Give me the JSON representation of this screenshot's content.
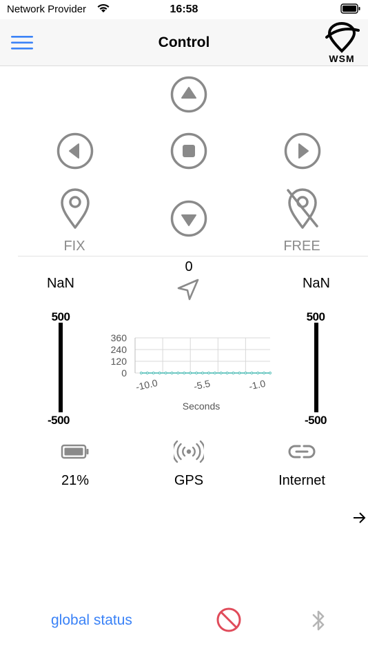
{
  "status_bar": {
    "carrier": "Network Provider",
    "time": "16:58",
    "icons": [
      "wifi-icon",
      "battery-icon"
    ]
  },
  "nav": {
    "title": "Control",
    "menu_icon": "hamburger-menu-icon",
    "logo_text": "WSM"
  },
  "controls": {
    "buttons": [
      "arrow-up-circle",
      "arrow-left-circle",
      "stop-circle",
      "arrow-right-circle",
      "arrow-down-circle"
    ],
    "fix_label": "FIX",
    "free_label": "FREE"
  },
  "heading": {
    "value": "0",
    "icon": "navigation-arrow-icon"
  },
  "left_reading": "NaN",
  "right_reading": "NaN",
  "left_gauge": {
    "max": "500",
    "min": "-500"
  },
  "right_gauge": {
    "max": "500",
    "min": "-500"
  },
  "chart_data": {
    "type": "line",
    "xlabel": "Seconds",
    "ylabel": "",
    "y_ticks": [
      "360",
      "240",
      "120",
      "0"
    ],
    "x_ticks": [
      "-10.0",
      "-5.5",
      "-1.0"
    ],
    "ylim": [
      0,
      360
    ],
    "xlim": [
      -11,
      0
    ],
    "series": [
      {
        "color": "#40b7b0",
        "x": [
          -10.5,
          -10.0,
          -9.5,
          -9.0,
          -8.5,
          -8.0,
          -7.5,
          -7.0,
          -6.5,
          -6.0,
          -5.5,
          -5.0,
          -4.5,
          -4.0,
          -3.5,
          -3.0,
          -2.5,
          -2.0,
          -1.5,
          -1.0,
          -0.5,
          0.0
        ],
        "values": [
          0,
          0,
          0,
          0,
          0,
          0,
          0,
          0,
          0,
          0,
          0,
          0,
          0,
          0,
          0,
          0,
          0,
          0,
          0,
          0,
          0,
          0
        ]
      }
    ]
  },
  "status": {
    "battery": {
      "icon": "battery-icon",
      "label": "21%"
    },
    "gps": {
      "icon": "gps-signal-icon",
      "label": "GPS"
    },
    "internet": {
      "icon": "link-icon",
      "label": "Internet"
    }
  },
  "bottom": {
    "global_status": "global status",
    "ban_icon": "no-entry-icon",
    "bluetooth_icon": "bluetooth-icon"
  },
  "colors": {
    "accent": "#3a82f7",
    "control_gray": "#8a8a8a",
    "chart_line": "#40b7b0",
    "ban_red": "#e04b5a"
  }
}
